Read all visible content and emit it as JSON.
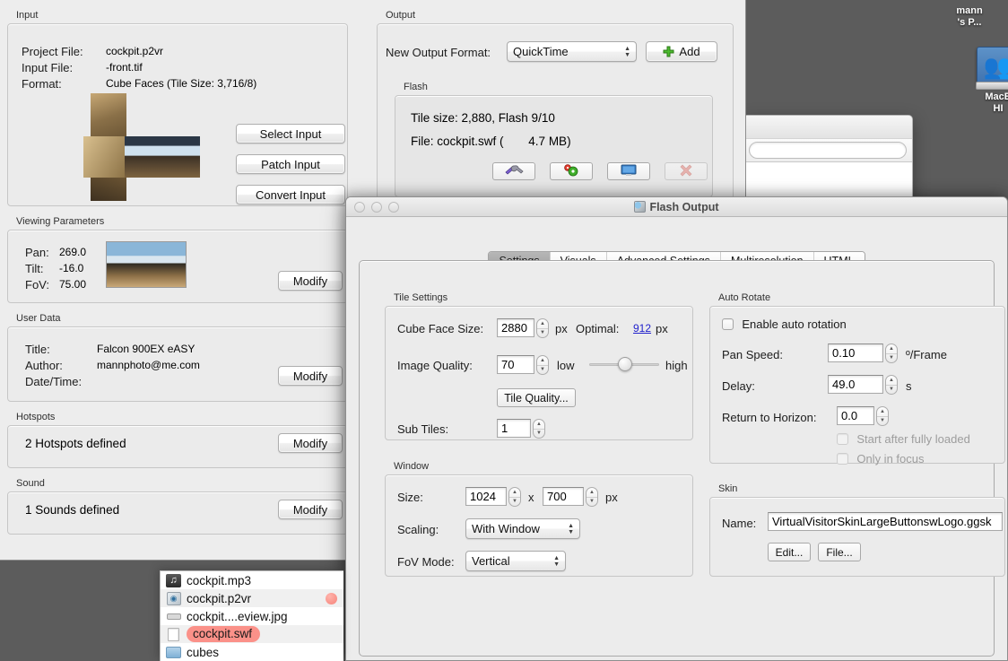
{
  "desktop": {
    "icons": [
      {
        "name": "mann's P...",
        "label_line1": "mann",
        "label_line2": "'s P...",
        "glyph": "users-shared-folder-icon"
      },
      {
        "name": "MacBook HD",
        "label_line1": "MacB",
        "label_line2": "HI",
        "glyph": "hard-disk-icon"
      }
    ]
  },
  "main_window": {
    "input_group": {
      "title": "Input",
      "fields": [
        {
          "label": "Project File:",
          "value": "cockpit.p2vr"
        },
        {
          "label": "Input File:",
          "value": "-front.tif"
        },
        {
          "label": "Format:",
          "value": "Cube Faces (Tile Size: 3,716/8)"
        }
      ],
      "buttons": [
        "Select Input",
        "Patch Input",
        "Convert Input"
      ],
      "thumbnail_name": "cube-faces-preview"
    },
    "viewing_group": {
      "title": "Viewing Parameters",
      "fields": [
        {
          "label": "Pan:",
          "value": "269.0"
        },
        {
          "label": "Tilt:",
          "value": "-16.0"
        },
        {
          "label": "FoV:",
          "value": "75.00"
        }
      ],
      "modify_label": "Modify",
      "thumbnail_name": "cockpit-panorama-preview"
    },
    "user_data_group": {
      "title": "User Data",
      "fields": [
        {
          "label": "Title:",
          "value": "Falcon 900EX eASY"
        },
        {
          "label": "Author:",
          "value": "mannphoto@me.com"
        },
        {
          "label": "Date/Time:",
          "value": ""
        }
      ],
      "modify_label": "Modify"
    },
    "hotspots_group": {
      "title": "Hotspots",
      "summary": "2 Hotspots defined",
      "modify_label": "Modify"
    },
    "sound_group": {
      "title": "Sound",
      "summary": "1 Sounds defined",
      "modify_label": "Modify"
    },
    "output_group": {
      "title": "Output",
      "format_label": "New Output Format:",
      "format_value": "QuickTime",
      "add_label": "Add",
      "flash_panel": {
        "title": "Flash",
        "tile_line": "Tile size: 2,880, Flash 9/10",
        "file_line_prefix": "File: cockpit.swf (",
        "file_size": "4.7 MB)",
        "buttons": [
          {
            "name": "settings-tools-button",
            "icon": "wrench-screwdriver-icon",
            "enabled": true
          },
          {
            "name": "process-gears-button",
            "icon": "gears-icon",
            "enabled": true
          },
          {
            "name": "preview-monitor-button",
            "icon": "monitor-icon",
            "enabled": true
          },
          {
            "name": "delete-button",
            "icon": "red-x-icon",
            "enabled": false
          }
        ]
      }
    }
  },
  "flash_dialog": {
    "title": "Flash Output",
    "title_icon": "flash-output-icon",
    "window_controls": [
      "close",
      "minimize",
      "zoom"
    ],
    "tabs": [
      {
        "label": "Settings",
        "active": true
      },
      {
        "label": "Visuals",
        "active": false
      },
      {
        "label": "Advanced Settings",
        "active": false
      },
      {
        "label": "Multiresolution",
        "active": false
      },
      {
        "label": "HTML",
        "active": false
      }
    ],
    "tile_settings": {
      "title": "Tile Settings",
      "cube_face_size_label": "Cube Face Size:",
      "cube_face_size_value": "2880",
      "cube_face_size_unit": "px",
      "optimal_label": "Optimal:",
      "optimal_value": "912",
      "optimal_unit": "px",
      "image_quality_label": "Image Quality:",
      "image_quality_value": "70",
      "slider_low": "low",
      "slider_high": "high",
      "slider_percent": 52,
      "tile_quality_button": "Tile Quality...",
      "sub_tiles_label": "Sub Tiles:",
      "sub_tiles_value": "1"
    },
    "window_settings": {
      "title": "Window",
      "size_label": "Size:",
      "width_value": "1024",
      "times": "x",
      "height_value": "700",
      "size_unit": "px",
      "scaling_label": "Scaling:",
      "scaling_value": "With Window",
      "fov_mode_label": "FoV Mode:",
      "fov_mode_value": "Vertical"
    },
    "auto_rotate": {
      "title": "Auto Rotate",
      "enable_label": "Enable auto rotation",
      "enable_checked": false,
      "pan_speed_label": "Pan Speed:",
      "pan_speed_value": "0.10",
      "pan_speed_unit": "º/Frame",
      "delay_label": "Delay:",
      "delay_value": "49.0",
      "delay_unit": "s",
      "return_label": "Return to Horizon:",
      "return_value": "0.0",
      "start_after_label": "Start after fully loaded",
      "start_after_checked": false,
      "only_focus_label": "Only in focus",
      "only_focus_checked": false
    },
    "skin": {
      "title": "Skin",
      "name_label": "Name:",
      "name_value": "VirtualVisitorSkinLargeButtonswLogo.ggsk",
      "edit_label": "Edit...",
      "file_label": "File..."
    }
  },
  "file_list": {
    "rows": [
      {
        "name": "cockpit.mp3",
        "icon": "mp3-icon",
        "tagged": false,
        "dot": false,
        "alt": false
      },
      {
        "name": "cockpit.p2vr",
        "icon": "p2vr-icon",
        "tagged": false,
        "dot": true,
        "alt": true
      },
      {
        "name": "cockpit....eview.jpg",
        "icon": "jpg-icon",
        "tagged": false,
        "dot": false,
        "alt": false
      },
      {
        "name": "cockpit.swf",
        "icon": "document-icon",
        "tagged": true,
        "dot": false,
        "alt": true
      },
      {
        "name": "cubes",
        "icon": "folder-icon",
        "tagged": false,
        "dot": false,
        "alt": false
      }
    ]
  },
  "colors": {
    "desktop": "#5c5c5c",
    "window_bg": "#ededed",
    "tag_red": "#fb9189",
    "link_blue": "#2222cc",
    "active_tab": "#ababab"
  }
}
